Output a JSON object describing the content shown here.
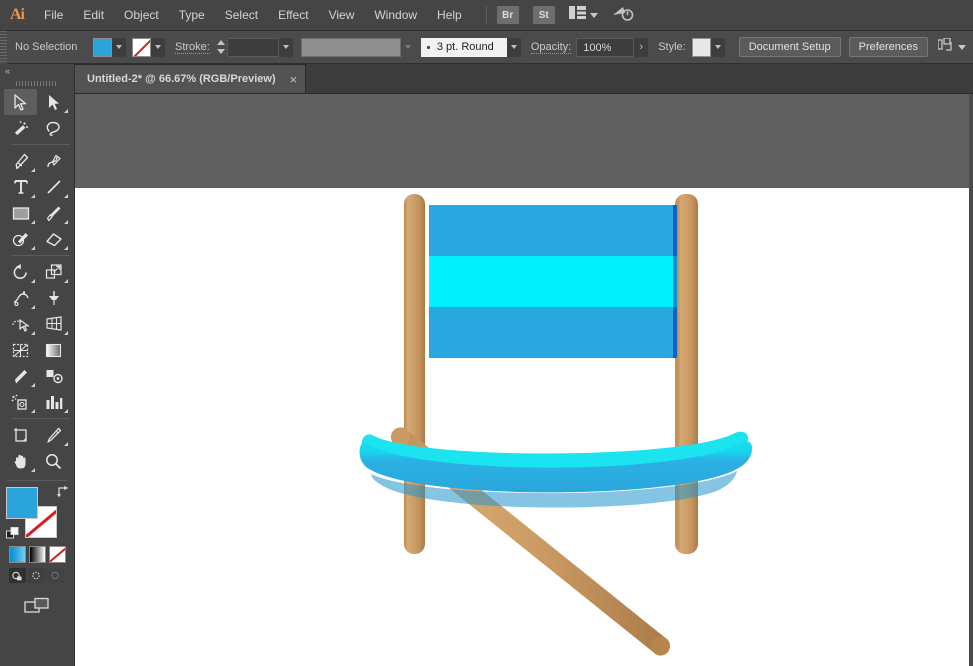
{
  "app": {
    "name": "Adobe Illustrator",
    "logo_text": "Ai"
  },
  "menubar": {
    "items": [
      {
        "label": "File"
      },
      {
        "label": "Edit"
      },
      {
        "label": "Object"
      },
      {
        "label": "Type"
      },
      {
        "label": "Select"
      },
      {
        "label": "Effect"
      },
      {
        "label": "View"
      },
      {
        "label": "Window"
      },
      {
        "label": "Help"
      }
    ],
    "bridge_label": "Br",
    "stock_label": "St",
    "workspace_icon": "workspace-switcher-icon",
    "cloud_icon": "cloud-sync-icon"
  },
  "controlbar": {
    "selection_status": "No Selection",
    "fill_label": "fill-swatch",
    "fill_color": "#2BA4DC",
    "stroke_swatch_label": "stroke-swatch-none",
    "stroke_label": "Stroke:",
    "stroke_weight_value": "",
    "brush_definition_value": "",
    "profile_value": "3 pt. Round",
    "opacity_label": "Opacity:",
    "opacity_value": "100%",
    "style_label": "Style:",
    "style_swatch_color": "#E8E8E8",
    "document_setup_label": "Document Setup",
    "preferences_label": "Preferences",
    "align_icon": "align-objects-icon"
  },
  "tabbar": {
    "tabs": [
      {
        "title": "Untitled-2* @ 66.67% (RGB/Preview)",
        "close_label": "×",
        "active": true
      }
    ]
  },
  "toolbar": {
    "collapse_label": "«",
    "tools": [
      {
        "name": "selection-tool",
        "active": true,
        "has_flyout": false
      },
      {
        "name": "direct-selection-tool",
        "active": false,
        "has_flyout": true
      },
      {
        "name": "magic-wand-tool",
        "active": false,
        "has_flyout": false
      },
      {
        "name": "lasso-tool",
        "active": false,
        "has_flyout": false
      },
      {
        "name": "pen-tool",
        "active": false,
        "has_flyout": true
      },
      {
        "name": "curvature-tool",
        "active": false,
        "has_flyout": false
      },
      {
        "name": "type-tool",
        "active": false,
        "has_flyout": true
      },
      {
        "name": "line-segment-tool",
        "active": false,
        "has_flyout": true
      },
      {
        "name": "rectangle-tool",
        "active": false,
        "has_flyout": true
      },
      {
        "name": "paintbrush-tool",
        "active": false,
        "has_flyout": true
      },
      {
        "name": "shaper-tool",
        "active": false,
        "has_flyout": true
      },
      {
        "name": "eraser-tool",
        "active": false,
        "has_flyout": true
      },
      {
        "name": "rotate-tool",
        "active": false,
        "has_flyout": true
      },
      {
        "name": "scale-tool",
        "active": false,
        "has_flyout": true
      },
      {
        "name": "width-tool",
        "active": false,
        "has_flyout": true
      },
      {
        "name": "free-transform-tool",
        "active": false,
        "has_flyout": false
      },
      {
        "name": "shape-builder-tool",
        "active": false,
        "has_flyout": true
      },
      {
        "name": "perspective-grid-tool",
        "active": false,
        "has_flyout": true
      },
      {
        "name": "mesh-tool",
        "active": false,
        "has_flyout": false
      },
      {
        "name": "gradient-tool",
        "active": false,
        "has_flyout": false
      },
      {
        "name": "eyedropper-tool",
        "active": false,
        "has_flyout": true
      },
      {
        "name": "blend-tool",
        "active": false,
        "has_flyout": false
      },
      {
        "name": "symbol-sprayer-tool",
        "active": false,
        "has_flyout": true
      },
      {
        "name": "column-graph-tool",
        "active": false,
        "has_flyout": true
      },
      {
        "name": "artboard-tool",
        "active": false,
        "has_flyout": false
      },
      {
        "name": "slice-tool",
        "active": false,
        "has_flyout": true
      },
      {
        "name": "hand-tool",
        "active": false,
        "has_flyout": true
      },
      {
        "name": "zoom-tool",
        "active": false,
        "has_flyout": false
      }
    ],
    "fill_color": "#2BA4DC",
    "stroke_state": "none",
    "mode_swatches": [
      "color-swatch",
      "gradient-swatch",
      "none-swatch"
    ],
    "draw_modes": [
      "draw-normal",
      "draw-behind",
      "draw-inside"
    ],
    "screen_mode": "change-screen-mode"
  },
  "artwork": {
    "title": "wooden-frame-with-blue-stripes-and-seat",
    "canvas_bg": "#606060",
    "artboard_bg": "#FFFFFF",
    "colors": {
      "wood_light": "#D2A46C",
      "wood_mid": "#C59460",
      "wood_dark": "#A9794A",
      "stripe_blue": "#29A8E0",
      "stripe_cyan": "#00F0FF",
      "overlap_dark_blue": "#0A63C8",
      "overlap_mid_blue": "#0E8FD8",
      "seat_cyan": "#1BE4F0",
      "seat_blue": "#29AADF",
      "seat_shadow": "#1F90C4"
    },
    "elements": [
      {
        "name": "left-post",
        "type": "wooden-post"
      },
      {
        "name": "right-post",
        "type": "wooden-post"
      },
      {
        "name": "stripe-band-top",
        "type": "blue-stripe"
      },
      {
        "name": "stripe-band-middle",
        "type": "cyan-stripe"
      },
      {
        "name": "stripe-band-bottom",
        "type": "blue-stripe"
      },
      {
        "name": "overlap-panel",
        "type": "multiply-overlap"
      },
      {
        "name": "curved-seat",
        "type": "curved-bar"
      },
      {
        "name": "diagonal-leg",
        "type": "wooden-leg"
      }
    ]
  }
}
